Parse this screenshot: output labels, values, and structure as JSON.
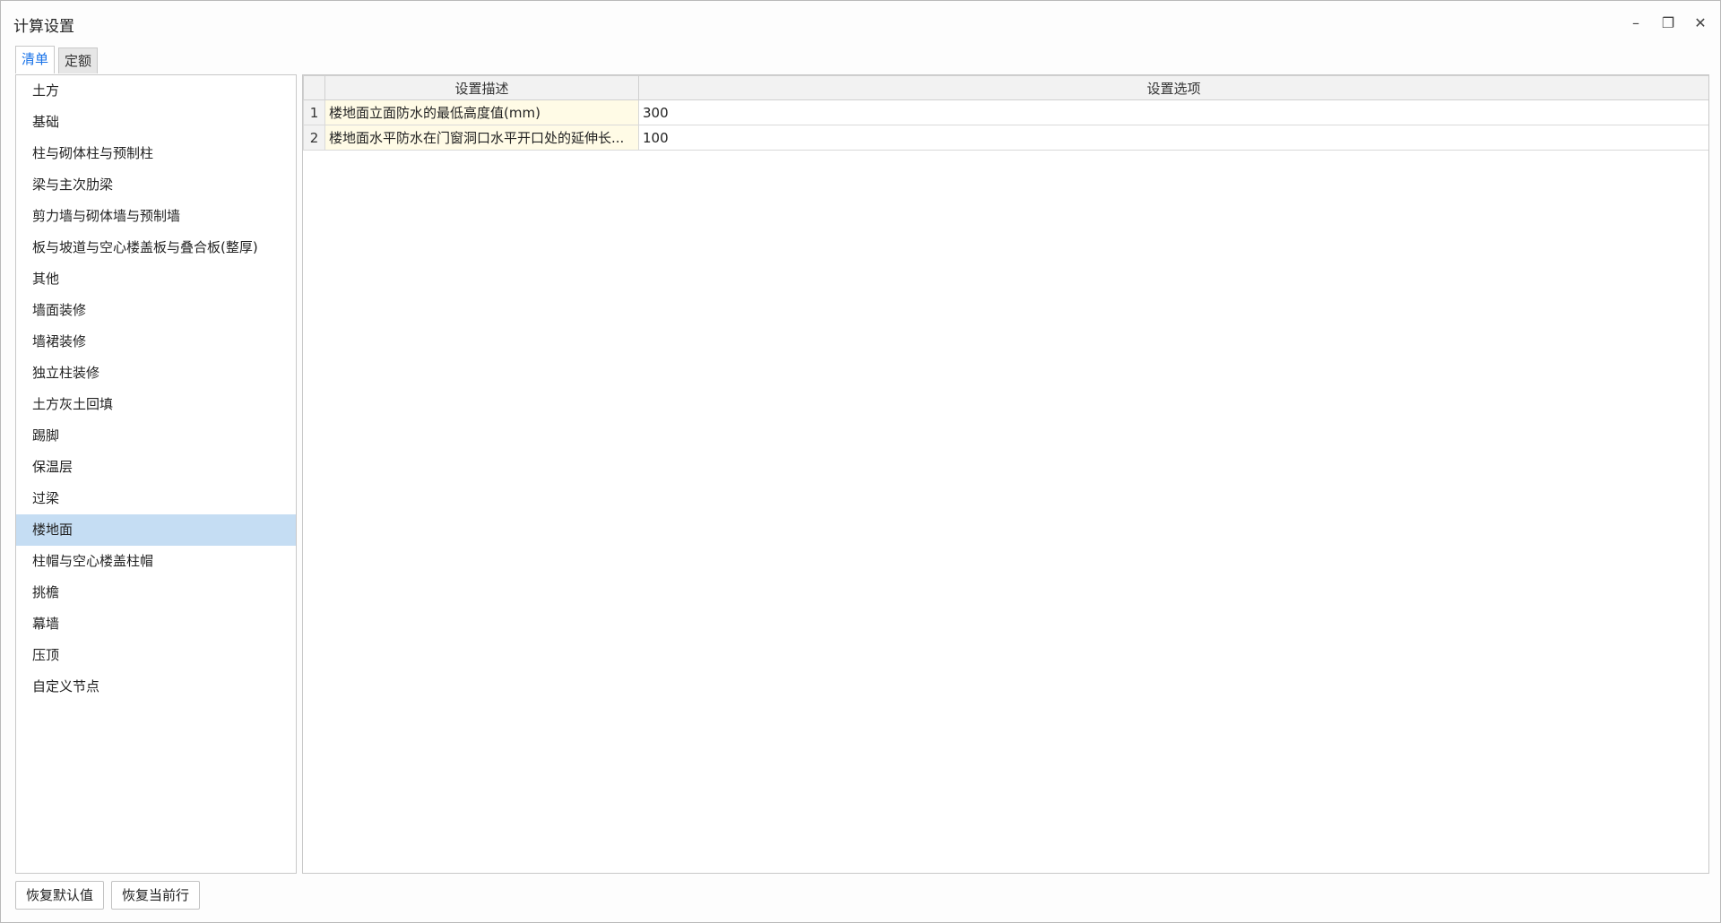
{
  "window": {
    "title": "计算设置",
    "controls": {
      "minimize": "–",
      "restore": "❐",
      "close": "✕"
    }
  },
  "tabs": [
    {
      "label": "清单",
      "active": true
    },
    {
      "label": "定额",
      "active": false
    }
  ],
  "sidebar": {
    "selected_index": 14,
    "items": [
      {
        "label": "土方"
      },
      {
        "label": "基础"
      },
      {
        "label": "柱与砌体柱与预制柱"
      },
      {
        "label": "梁与主次肋梁"
      },
      {
        "label": "剪力墙与砌体墙与预制墙"
      },
      {
        "label": "板与坡道与空心楼盖板与叠合板(整厚)"
      },
      {
        "label": "其他"
      },
      {
        "label": "墙面装修"
      },
      {
        "label": "墙裙装修"
      },
      {
        "label": "独立柱装修"
      },
      {
        "label": "土方灰土回填"
      },
      {
        "label": "踢脚"
      },
      {
        "label": "保温层"
      },
      {
        "label": "过梁"
      },
      {
        "label": "楼地面"
      },
      {
        "label": "柱帽与空心楼盖柱帽"
      },
      {
        "label": "挑檐"
      },
      {
        "label": "幕墙"
      },
      {
        "label": "压顶"
      },
      {
        "label": "自定义节点"
      }
    ]
  },
  "grid": {
    "columns": [
      "",
      "设置描述",
      "设置选项"
    ],
    "rows": [
      {
        "num": "1",
        "description": "楼地面立面防水的最低高度值(mm)",
        "option": "300"
      },
      {
        "num": "2",
        "description": "楼地面水平防水在门窗洞口水平开口处的延伸长...",
        "option": "100"
      }
    ]
  },
  "buttons": {
    "restore_default": "恢复默认值",
    "restore_current_row": "恢复当前行"
  },
  "colors": {
    "selected_row": "#c5ddf3",
    "desc_cell_bg": "#fffbe6",
    "active_tab_text": "#1a73e8"
  }
}
